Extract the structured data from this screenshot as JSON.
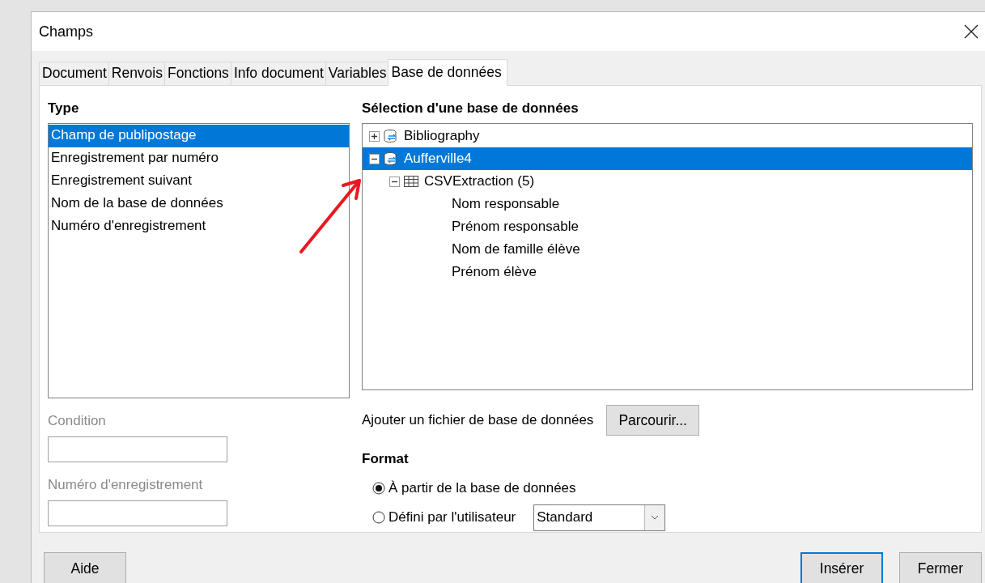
{
  "window": {
    "title": "Champs"
  },
  "tabs": [
    {
      "label": "Document",
      "selected": false
    },
    {
      "label": "Renvois",
      "selected": false
    },
    {
      "label": "Fonctions",
      "selected": false
    },
    {
      "label": "Info document",
      "selected": false
    },
    {
      "label": "Variables",
      "selected": false
    },
    {
      "label": "Base de données",
      "selected": true
    }
  ],
  "type_panel": {
    "heading": "Type",
    "items": [
      {
        "label": "Champ de publipostage",
        "selected": true
      },
      {
        "label": "Enregistrement par numéro",
        "selected": false
      },
      {
        "label": "Enregistrement suivant",
        "selected": false
      },
      {
        "label": "Nom de la base de données",
        "selected": false
      },
      {
        "label": "Numéro d'enregistrement",
        "selected": false
      }
    ],
    "fields": [
      {
        "label": "Condition",
        "disabled": true
      },
      {
        "label": "Numéro d'enregistrement",
        "disabled": true
      }
    ]
  },
  "database_panel": {
    "heading": "Sélection d'une base de données",
    "tree": [
      {
        "label": "Bibliography",
        "kind": "database",
        "expanded": false,
        "selected": false
      },
      {
        "label": "Aufferville4",
        "kind": "database",
        "expanded": true,
        "selected": true,
        "children": [
          {
            "label": "CSVExtraction (5)",
            "kind": "table",
            "expanded": true,
            "selected": false,
            "children": [
              {
                "label": "Nom responsable",
                "kind": "field",
                "selected": false
              },
              {
                "label": "Prénom responsable",
                "kind": "field",
                "selected": false
              },
              {
                "label": "Nom de famille élève",
                "kind": "field",
                "selected": false
              },
              {
                "label": "Prénom élève",
                "kind": "field",
                "selected": false
              }
            ]
          }
        ]
      }
    ],
    "add_file": {
      "label": "Ajouter un fichier de base de données",
      "button": "Parcourir..."
    },
    "format": {
      "heading": "Format",
      "options": [
        {
          "label": "À partir de la base de données",
          "selected": true
        },
        {
          "label": "Défini par l'utilisateur",
          "selected": false,
          "dropdown": "Standard"
        }
      ]
    }
  },
  "help_button": {
    "label": "Aide"
  },
  "buttons": [
    {
      "label": "Insérer",
      "default": true
    },
    {
      "label": "Fermer",
      "default": false
    }
  ]
}
